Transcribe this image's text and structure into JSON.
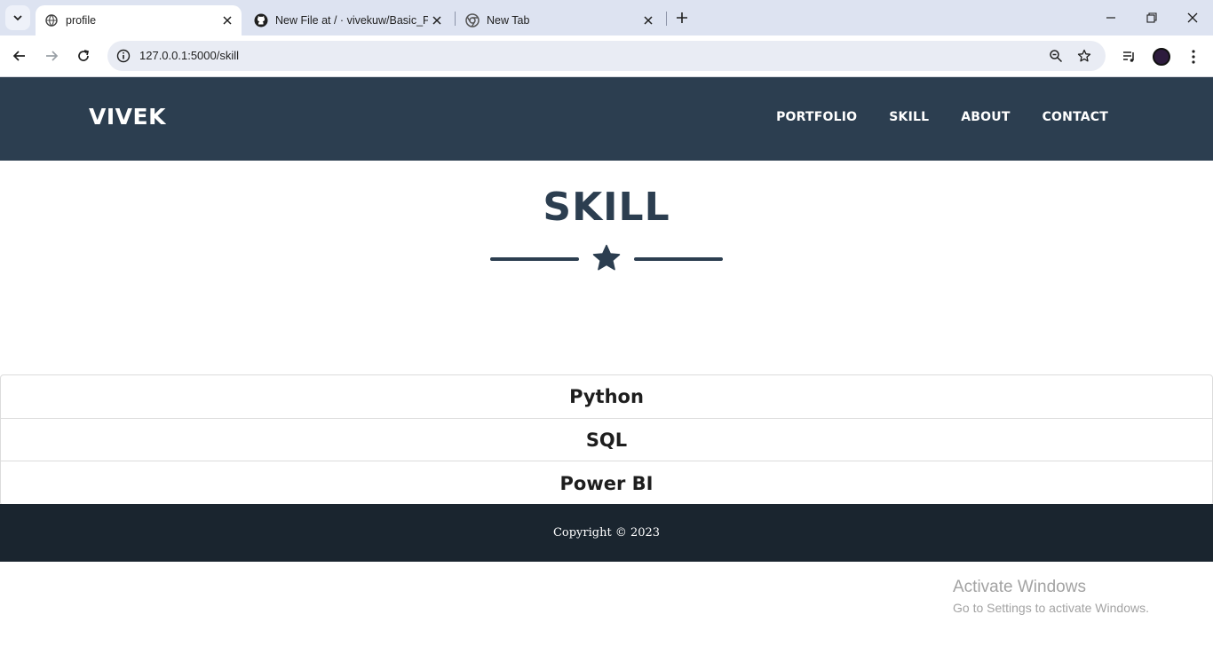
{
  "browser": {
    "tabs": [
      {
        "title": "profile",
        "icon": "globe-icon",
        "active": true
      },
      {
        "title": "New File at / · vivekuw/Basic_Po",
        "icon": "github-icon",
        "active": false
      },
      {
        "title": "New Tab",
        "icon": "chrome-icon",
        "active": false
      }
    ],
    "url": "127.0.0.1:5000/skill"
  },
  "site": {
    "brand": "VIVEK",
    "nav": [
      "PORTFOLIO",
      "SKILL",
      "ABOUT",
      "CONTACT"
    ],
    "heading": "SKILL",
    "skills": [
      "Python",
      "SQL",
      "Power BI"
    ],
    "footer": "Copyright © 2023"
  },
  "watermark": {
    "line1": "Activate Windows",
    "line2": "Go to Settings to activate Windows."
  },
  "colors": {
    "header_bg": "#2c3e50",
    "footer_bg": "#1a252f",
    "tabstrip_bg": "#dde3f1"
  }
}
